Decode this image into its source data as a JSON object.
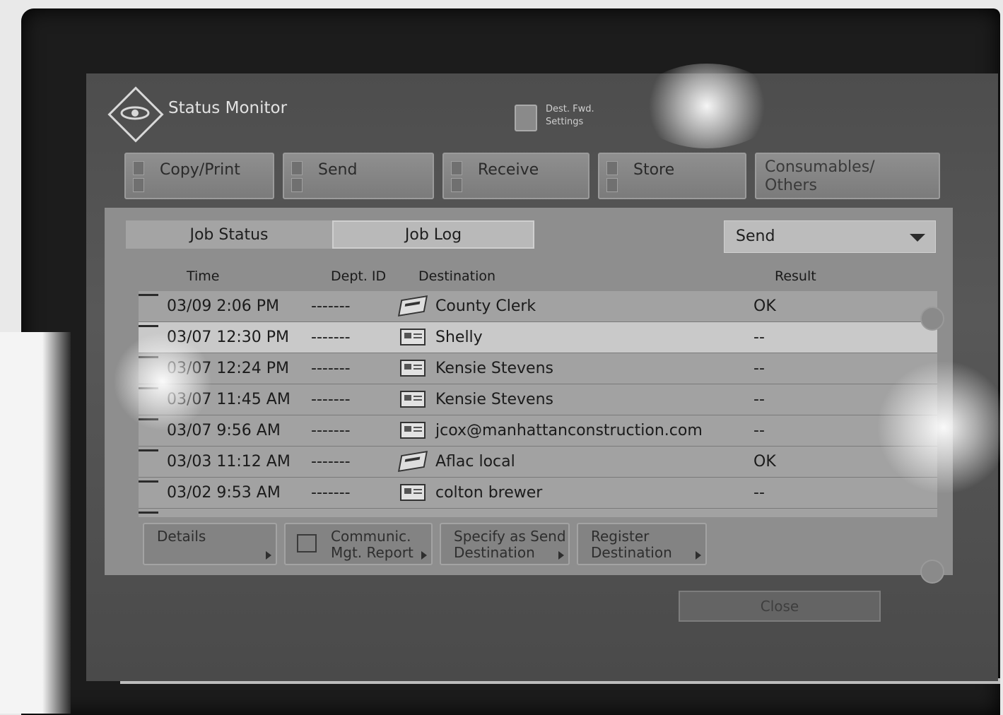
{
  "header": {
    "title": "Status Monitor",
    "dest_settings": "Dest. Fwd. Settings"
  },
  "category_tabs": [
    {
      "label": "Copy/Print"
    },
    {
      "label": "Send"
    },
    {
      "label": "Receive"
    },
    {
      "label": "Store"
    },
    {
      "label": "Consumables/ Others"
    }
  ],
  "subtabs": {
    "job_status": "Job Status",
    "job_log": "Job Log"
  },
  "filter": {
    "selected": "Send"
  },
  "table": {
    "headers": {
      "time": "Time",
      "dept_id": "Dept. ID",
      "destination": "Destination",
      "result": "Result"
    },
    "rows": [
      {
        "time": "03/09 2:06 PM",
        "dept": "-------",
        "dest": "County Clerk",
        "icon": "fax-icon",
        "result": "OK"
      },
      {
        "time": "03/07 12:30 PM",
        "dept": "-------",
        "dest": "Shelly",
        "icon": "email-card-icon",
        "result": "--"
      },
      {
        "time": "03/07 12:24 PM",
        "dept": "-------",
        "dest": "Kensie Stevens",
        "icon": "email-card-icon",
        "result": "--"
      },
      {
        "time": "03/07 11:45 AM",
        "dept": "-------",
        "dest": "Kensie Stevens",
        "icon": "email-card-icon",
        "result": "--"
      },
      {
        "time": "03/07 9:56 AM",
        "dept": "-------",
        "dest": "jcox@manhattanconstruction.com",
        "icon": "email-card-icon",
        "result": "--"
      },
      {
        "time": "03/03 11:12 AM",
        "dept": "-------",
        "dest": "Aflac local",
        "icon": "fax-icon",
        "result": "OK"
      },
      {
        "time": "03/02 9:53 AM",
        "dept": "-------",
        "dest": "colton brewer",
        "icon": "email-card-icon",
        "result": "--"
      }
    ]
  },
  "actions": {
    "details": "Details",
    "communic": "Communic. Mgt. Report",
    "specify": "Specify as Send Destination",
    "register": "Register Destination"
  },
  "close_label": "Close"
}
